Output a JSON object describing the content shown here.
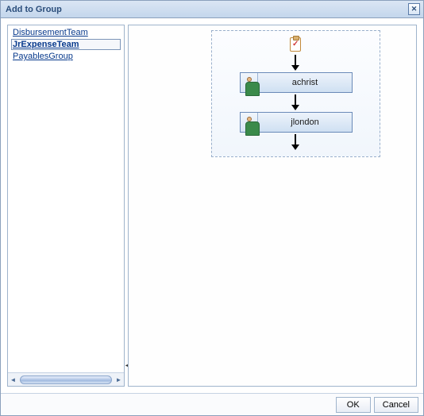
{
  "dialog": {
    "title": "Add to Group"
  },
  "groups": {
    "items": [
      {
        "label": "DisbursementTeam"
      },
      {
        "label": "JrExpenseTeam"
      },
      {
        "label": "PayablesGroup"
      }
    ]
  },
  "flow": {
    "nodes": [
      {
        "label": "achrist"
      },
      {
        "label": "jlondon"
      }
    ]
  },
  "buttons": {
    "ok": "OK",
    "cancel": "Cancel"
  }
}
